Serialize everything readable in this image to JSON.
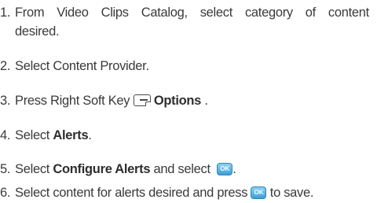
{
  "steps": [
    {
      "number": "1.",
      "line1_words": [
        "From",
        "Video",
        "Clips",
        "Catalog,",
        "select",
        "category",
        "of",
        "content"
      ],
      "line2": "desired."
    },
    {
      "number": "2.",
      "text": "Select Content Provider."
    },
    {
      "number": "3.",
      "before": "Press Right Soft Key",
      "bold": "Options",
      "after": ".",
      "icon": "right-soft-key-icon"
    },
    {
      "number": "4.",
      "before": "Select",
      "bold": "Alerts",
      "after": "."
    },
    {
      "number": "5.",
      "before": "Select",
      "bold": "Configure Alerts",
      "middle": "and select",
      "after": ".",
      "icon": "ok-key-icon",
      "icon_label": "OK"
    },
    {
      "number": "6.",
      "before": "Select content for alerts desired and press",
      "after": "to save.",
      "icon": "ok-key-icon",
      "icon_label": "OK"
    }
  ],
  "colors": {
    "text": "#3a3a3a",
    "ok_key": "#3d9fd6"
  }
}
